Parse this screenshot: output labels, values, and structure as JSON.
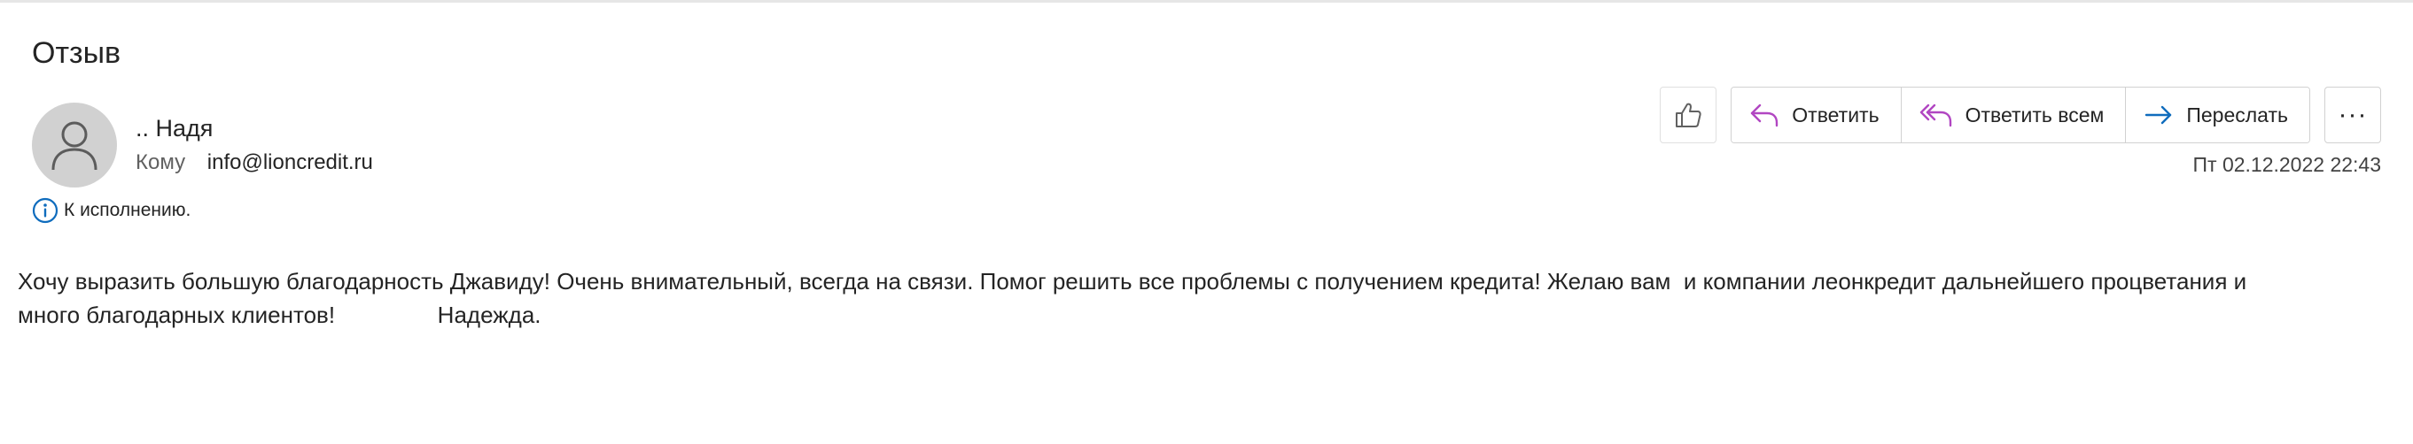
{
  "message": {
    "subject": "Отзыв",
    "sender_name": ".. Надя",
    "to_label": "Кому",
    "to_address": "info@lioncredit.ru",
    "status_text": "К исполнению.",
    "date": "Пт 02.12.2022 22:43",
    "body_lines": [
      "Хочу выразить большую благодарность Джавиду! Очень внимательный, всегда на связи. Помог решить все проблемы с получением кредита! Желаю вам  и компании леонкредит дальнейшего процветания и",
      "много благодарных клиентов!                Надежда."
    ]
  },
  "toolbar": {
    "reply_label": "Ответить",
    "reply_all_label": "Ответить всем",
    "forward_label": "Переслать",
    "more_label": "···"
  },
  "icons": {
    "like": "thumbs-up-icon",
    "reply": "reply-arrow-icon",
    "reply_all": "reply-all-arrow-icon",
    "forward": "forward-arrow-icon",
    "more": "ellipsis-icon",
    "info": "info-icon",
    "avatar": "person-icon"
  },
  "colors": {
    "reply_icon": "#b146c2",
    "forward_icon": "#0f6cbd",
    "info_icon": "#0f6cbd",
    "avatar_bg": "#d1d1d1"
  }
}
